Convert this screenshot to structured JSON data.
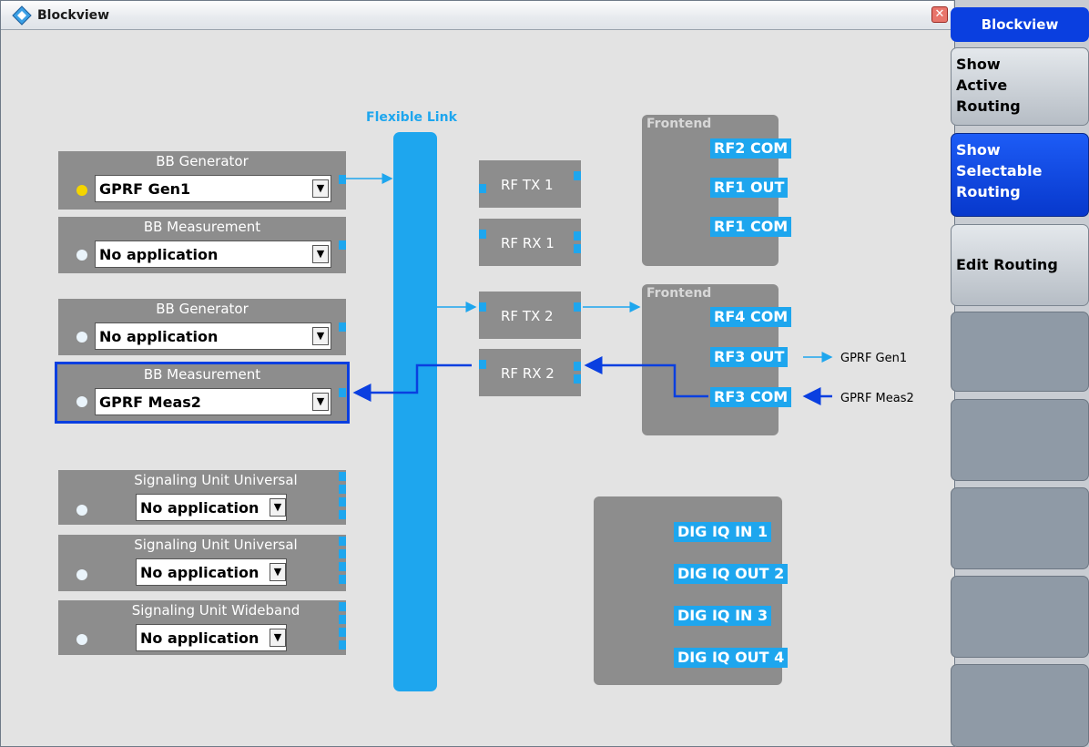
{
  "window": {
    "title": "Blockview",
    "close_symbol": "✕"
  },
  "colors": {
    "accent": "#1ea6ee",
    "route": "#0a3fe0",
    "block": "#8d8d8d",
    "selected_border": "#0a3fe0"
  },
  "flexible_link": {
    "label": "Flexible Link"
  },
  "left_blocks": [
    {
      "title": "BB Generator",
      "value": "GPRF Gen1",
      "led": "on"
    },
    {
      "title": "BB Measurement",
      "value": "No application",
      "led": "off"
    },
    {
      "title": "BB Generator",
      "value": "No application",
      "led": "off"
    },
    {
      "title": "BB Measurement",
      "value": "GPRF Meas2",
      "led": "off",
      "selected": true
    },
    {
      "title": "Signaling Unit Universal",
      "value": "No application",
      "led": "off"
    },
    {
      "title": "Signaling Unit Universal",
      "value": "No application",
      "led": "off"
    },
    {
      "title": "Signaling Unit Wideband",
      "value": "No application",
      "led": "off"
    }
  ],
  "dropdown_arrow": "▼",
  "rf_blocks": [
    "RF TX 1",
    "RF RX 1",
    "RF TX 2",
    "RF RX 2"
  ],
  "frontends": [
    {
      "label": "Frontend",
      "connectors": [
        "RF2 COM",
        "RF1 OUT",
        "RF1 COM"
      ]
    },
    {
      "label": "Frontend",
      "connectors": [
        "RF4 COM",
        "RF3 OUT",
        "RF3 COM"
      ]
    }
  ],
  "external_routes": [
    {
      "connector": "RF3 OUT",
      "label": "GPRF Gen1"
    },
    {
      "connector": "RF3 COM",
      "label": "GPRF Meas2"
    }
  ],
  "dig_iq": [
    "DIG IQ IN 1",
    "DIG IQ OUT 2",
    "DIG IQ IN 3",
    "DIG IQ OUT 4"
  ],
  "panel": {
    "header": "Blockview",
    "buttons": [
      "Show\nActive\nRouting",
      "Show\nSelectable\nRouting",
      "Edit Routing",
      "",
      "",
      "",
      "",
      ""
    ]
  }
}
